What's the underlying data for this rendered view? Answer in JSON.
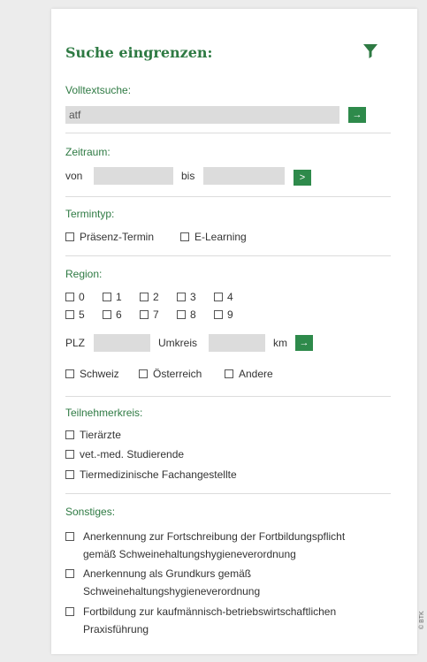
{
  "title": "Suche eingrenzen:",
  "icons": {
    "filter": "filter-icon",
    "go": "arrow-right-icon"
  },
  "colors": {
    "accent": "#2e7a43",
    "button": "#2e8a4b",
    "field": "#dcdcdc"
  },
  "volltext": {
    "label": "Volltextsuche:",
    "value": "atf",
    "button": "→"
  },
  "zeitraum": {
    "label": "Zeitraum:",
    "von": "von",
    "bis": "bis",
    "button": ">"
  },
  "termintyp": {
    "label": "Termintyp:",
    "options": [
      "Präsenz-Termin",
      "E-Learning"
    ]
  },
  "region": {
    "label": "Region:",
    "digits": [
      "0",
      "1",
      "2",
      "3",
      "4",
      "5",
      "6",
      "7",
      "8",
      "9"
    ],
    "plz": "PLZ",
    "umkreis": "Umkreis",
    "km": "km",
    "button": "→",
    "countries": [
      "Schweiz",
      "Österreich",
      "Andere"
    ]
  },
  "teilnehmerkreis": {
    "label": "Teilnehmerkreis:",
    "options": [
      "Tierärzte",
      "vet.-med. Studierende",
      "Tiermedizinische Fachangestellte"
    ]
  },
  "sonstiges": {
    "label": "Sonstiges:",
    "options": [
      {
        "line1": "Anerkennung zur Fortschreibung der Fortbildungspflicht",
        "line2": "gemäß Schweinehaltungshygieneverordnung"
      },
      {
        "line1": "Anerkennung als Grundkurs gemäß",
        "line2": "Schweinehaltungshygieneverordnung"
      },
      {
        "line1": "Fortbildung zur kaufmännisch-betriebswirtschaftlichen",
        "line2": "Praxisführung"
      }
    ]
  },
  "copyright": "© BTK"
}
